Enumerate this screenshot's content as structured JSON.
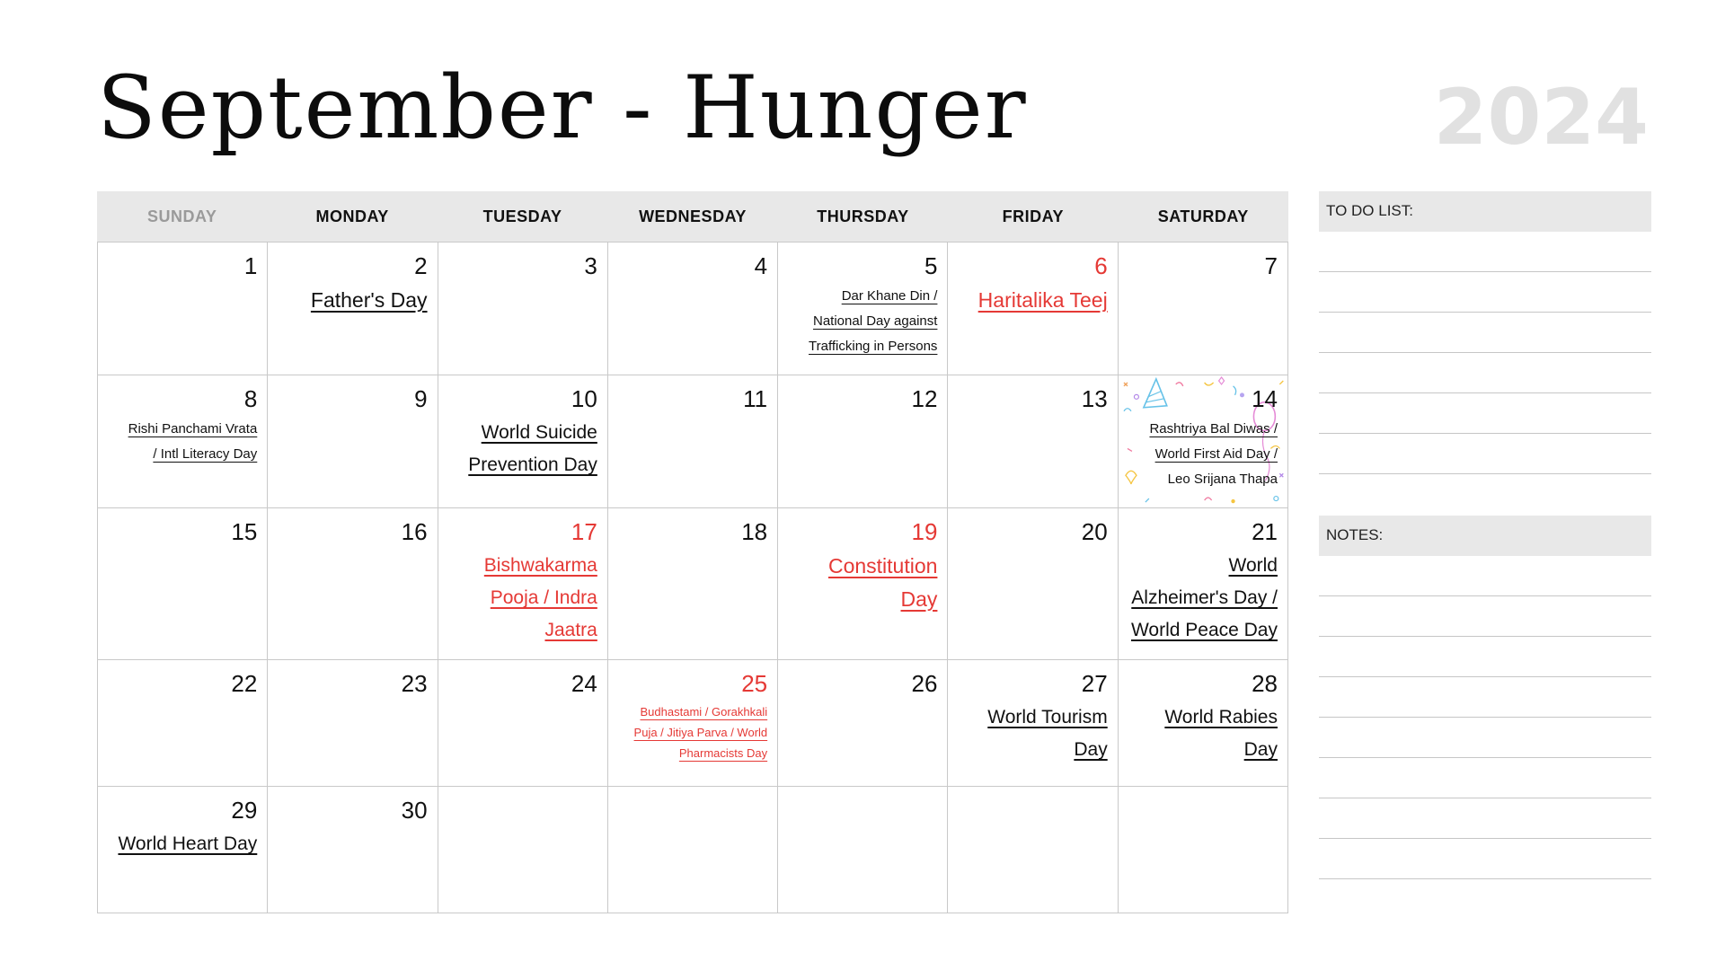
{
  "header": {
    "title": "September - Hunger",
    "year": "2024"
  },
  "weekdays": [
    "SUNDAY",
    "MONDAY",
    "TUESDAY",
    "WEDNESDAY",
    "THURSDAY",
    "FRIDAY",
    "SATURDAY"
  ],
  "days": {
    "d1": "1",
    "d2": "2",
    "d3": "3",
    "d4": "4",
    "d5": "5",
    "d6": "6",
    "d7": "7",
    "d8": "8",
    "d9": "9",
    "d10": "10",
    "d11": "11",
    "d12": "12",
    "d13": "13",
    "d14": "14",
    "d15": "15",
    "d16": "16",
    "d17": "17",
    "d18": "18",
    "d19": "19",
    "d20": "20",
    "d21": "21",
    "d22": "22",
    "d23": "23",
    "d24": "24",
    "d25": "25",
    "d26": "26",
    "d27": "27",
    "d28": "28",
    "d29": "29",
    "d30": "30"
  },
  "events": {
    "d2": "Father's Day",
    "d5": [
      "Dar Khane Din /",
      "National Day against",
      "Trafficking in Persons"
    ],
    "d6": "Haritalika Teej",
    "d8": [
      "Rishi Panchami Vrata",
      "/ Intl Literacy Day"
    ],
    "d10": [
      "World Suicide",
      "Prevention Day"
    ],
    "d14": [
      "Rashtriya Bal Diwas /",
      "World First Aid Day /"
    ],
    "d14_note": "Leo Srijana Thapa",
    "d17": [
      "Bishwakarma",
      "Pooja / Indra",
      "Jaatra"
    ],
    "d19": [
      "Constitution",
      "Day"
    ],
    "d21": [
      "World",
      "Alzheimer's Day /",
      "World Peace Day"
    ],
    "d25": [
      "Budhastami / Gorakhkali",
      "Puja / Jitiya Parva / World",
      "Pharmacists Day"
    ],
    "d27": [
      "World Tourism",
      "Day"
    ],
    "d28": [
      "World Rabies",
      "Day"
    ],
    "d29": "World Heart Day"
  },
  "sidebar": {
    "todo_label": "TO DO LIST:",
    "notes_label": "NOTES:"
  },
  "colors": {
    "holiday": "#e53935",
    "header_bg": "#e8e8e8",
    "year": "#e1e1e1",
    "grid": "#c9c9c9"
  },
  "icons": [
    "party-hat-icon",
    "balloon-icon",
    "confetti-icon"
  ]
}
